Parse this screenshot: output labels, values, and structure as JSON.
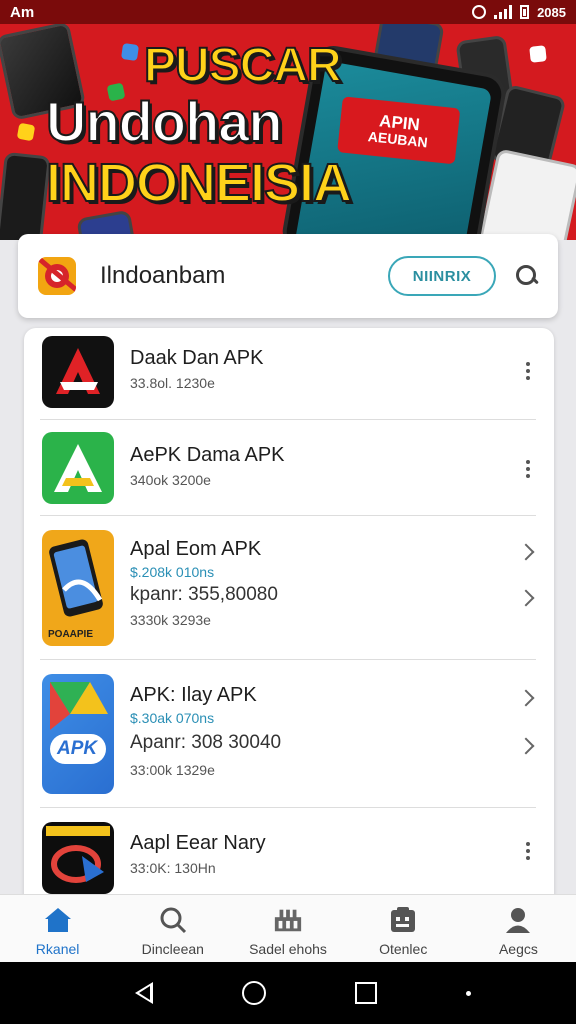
{
  "status_bar": {
    "carrier": "Am",
    "time": "2085"
  },
  "banner": {
    "line1": "PUSCAR",
    "line2": "Undohan",
    "line3": "INDONEISIA",
    "phone_tag_line1": "APIN",
    "phone_tag_line2": "AEUBAN"
  },
  "search_bar": {
    "app_name": "Ilndoanbam",
    "button_label": "NIINRIX"
  },
  "apps": [
    {
      "title": "Daak Dan APK",
      "meta": "33.8ol. 1230e"
    },
    {
      "title": "AePK Dama APK",
      "meta": "340ok 3200e"
    },
    {
      "title": "Apal Eom APK",
      "price": "$.208k 010ns",
      "detail": "kpanr: 355,80080",
      "meta": "3330k 3293e",
      "icon_caption": "POAAPIE"
    },
    {
      "title": "APK: Ilay APK",
      "price": "$.30ak 070ns",
      "detail": "Apanr: 308 30040",
      "meta": "33:00k 1329e",
      "icon_caption": "APK"
    },
    {
      "title": "Aapl Eear Nary",
      "meta": "33:0K: 130Hn"
    }
  ],
  "bottom_nav": [
    {
      "label": "Rkanel",
      "icon": "home-icon",
      "active": true
    },
    {
      "label": "Dincleean",
      "icon": "search-icon",
      "active": false
    },
    {
      "label": "Sadel ehohs",
      "icon": "store-icon",
      "active": false
    },
    {
      "label": "Otenlec",
      "icon": "tasks-icon",
      "active": false
    },
    {
      "label": "Aegcs",
      "icon": "account-icon",
      "active": false
    }
  ],
  "colors": {
    "banner_red": "#d41a1f",
    "banner_yellow": "#ffd21a",
    "accent_teal": "#3aa7b8",
    "nav_active": "#1f73c9"
  }
}
